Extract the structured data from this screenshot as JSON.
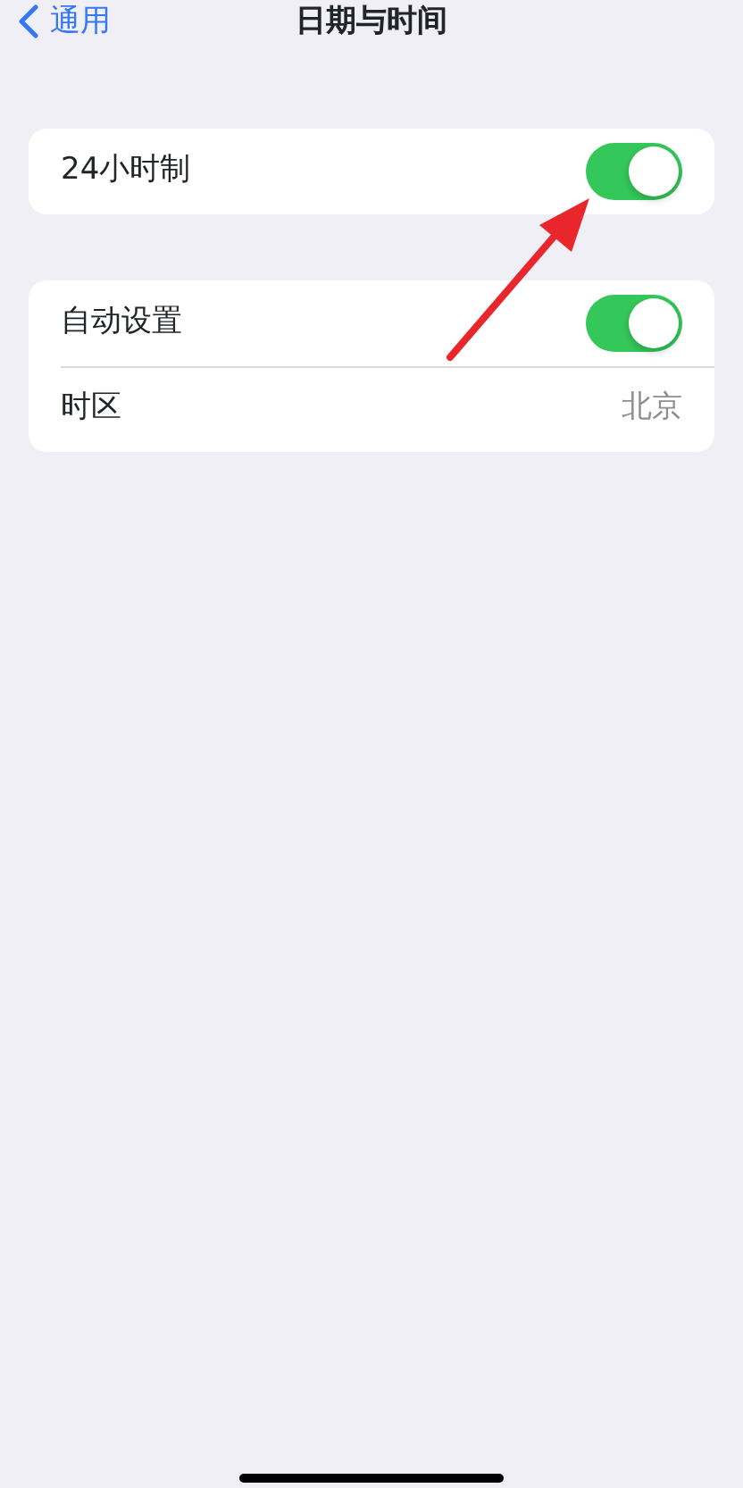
{
  "nav": {
    "back_label": "通用",
    "title": "日期与时间"
  },
  "groups": [
    {
      "rows": [
        {
          "kind": "toggle",
          "label": "24小时制",
          "on": true
        }
      ]
    },
    {
      "rows": [
        {
          "kind": "toggle",
          "label": "自动设置",
          "on": true
        },
        {
          "kind": "value",
          "label": "时区",
          "value": "北京"
        }
      ]
    }
  ]
}
